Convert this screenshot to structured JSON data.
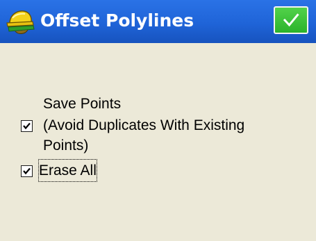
{
  "window": {
    "title": "Offset Polylines",
    "title_bar_color": "#1f64d8",
    "background_color": "#ece9d8",
    "app_icon": "surveyor-helmet-icon",
    "ok_button": {
      "icon": "checkmark-icon",
      "color": "#3cc23a"
    }
  },
  "save_points": {
    "label_line1": "Save Points",
    "label_line2": "(Avoid Duplicates With Existing",
    "label_line3": "Points)",
    "checked": true
  },
  "erase_all": {
    "label": "Erase All",
    "checked": true,
    "focused": true
  }
}
